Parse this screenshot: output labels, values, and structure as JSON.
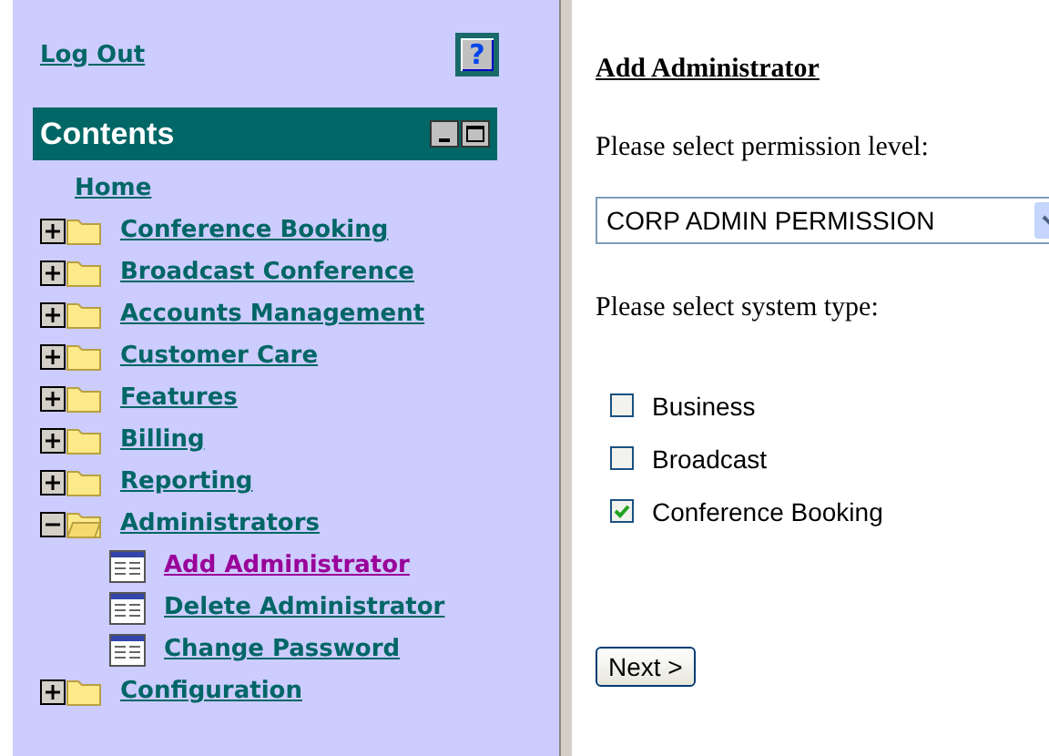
{
  "sidebar": {
    "logout": "Log Out",
    "help_button": "?",
    "contents_title": "Contents",
    "tree": [
      {
        "label": "Home",
        "kind": "link"
      },
      {
        "label": "Conference Booking",
        "kind": "folder",
        "expanded": false
      },
      {
        "label": "Broadcast Conference",
        "kind": "folder",
        "expanded": false
      },
      {
        "label": "Accounts Management",
        "kind": "folder",
        "expanded": false
      },
      {
        "label": "Customer Care",
        "kind": "folder",
        "expanded": false
      },
      {
        "label": "Features",
        "kind": "folder",
        "expanded": false
      },
      {
        "label": "Billing",
        "kind": "folder",
        "expanded": false
      },
      {
        "label": "Reporting",
        "kind": "folder",
        "expanded": false
      },
      {
        "label": "Administrators",
        "kind": "folder",
        "expanded": true,
        "children": [
          {
            "label": "Add Administrator",
            "selected": true
          },
          {
            "label": "Delete Administrator",
            "selected": false
          },
          {
            "label": "Change Password",
            "selected": false
          }
        ]
      },
      {
        "label": "Configuration",
        "kind": "folder",
        "expanded": false
      }
    ]
  },
  "form": {
    "title": "Add Administrator",
    "permission_label": "Please select permission level:",
    "permission": {
      "value": "CORP ADMIN PERMISSION"
    },
    "system_label": "Please select system type:",
    "system_types": [
      {
        "label": "Business",
        "checked": false
      },
      {
        "label": "Broadcast",
        "checked": false
      },
      {
        "label": "Conference Booking",
        "checked": true
      }
    ],
    "next_button": "Next >"
  }
}
